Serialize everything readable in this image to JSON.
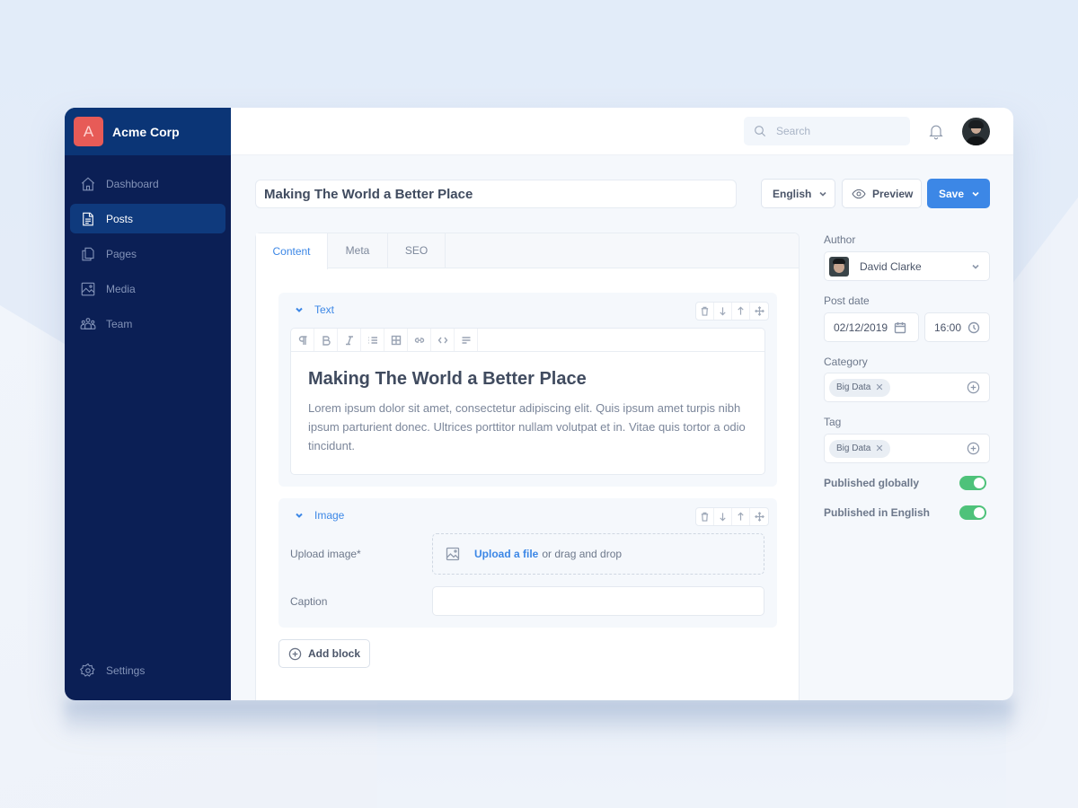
{
  "app": {
    "name": "Acme Corp",
    "logo_letter": "A",
    "accent": "#3c87e6",
    "sidebar_bg": "#0b1f55",
    "toggle_on_color": "#4ec27a"
  },
  "sidebar": {
    "items": [
      {
        "label": "Dashboard",
        "icon": "home-icon",
        "active": false
      },
      {
        "label": "Posts",
        "icon": "document-icon",
        "active": true
      },
      {
        "label": "Pages",
        "icon": "pages-icon",
        "active": false
      },
      {
        "label": "Media",
        "icon": "image-icon",
        "active": false
      },
      {
        "label": "Team",
        "icon": "team-icon",
        "active": false
      }
    ],
    "settings_label": "Settings"
  },
  "topbar": {
    "search_placeholder": "Search"
  },
  "post": {
    "title": "Making The World a Better Place",
    "language": "English",
    "preview_label": "Preview",
    "save_label": "Save"
  },
  "tabs": [
    {
      "label": "Content",
      "active": true
    },
    {
      "label": "Meta",
      "active": false
    },
    {
      "label": "SEO",
      "active": false
    }
  ],
  "blocks": {
    "text": {
      "label": "Text",
      "toolbar": [
        "paragraph",
        "bold",
        "italic",
        "list",
        "table",
        "link",
        "code",
        "align"
      ],
      "heading": "Making The World a Better Place",
      "body": "Lorem ipsum dolor sit amet, consectetur adipiscing elit. Quis ipsum amet turpis nibh ipsum parturient donec. Ultrices porttitor nullam volutpat et in. Vitae quis tortor a odio tincidunt."
    },
    "image": {
      "label": "Image",
      "upload_label": "Upload image*",
      "upload_link": "Upload a file",
      "upload_hint": "or drag and drop",
      "caption_label": "Caption",
      "caption_value": ""
    },
    "add_block_label": "Add block"
  },
  "meta": {
    "author_label": "Author",
    "author_name": "David Clarke",
    "post_date_label": "Post date",
    "date": "02/12/2019",
    "time": "16:00",
    "category_label": "Category",
    "category_chip": "Big Data",
    "tag_label": "Tag",
    "tag_chip": "Big Data",
    "published_globally_label": "Published globally",
    "published_globally": true,
    "published_english_label": "Published in English",
    "published_english": true
  }
}
